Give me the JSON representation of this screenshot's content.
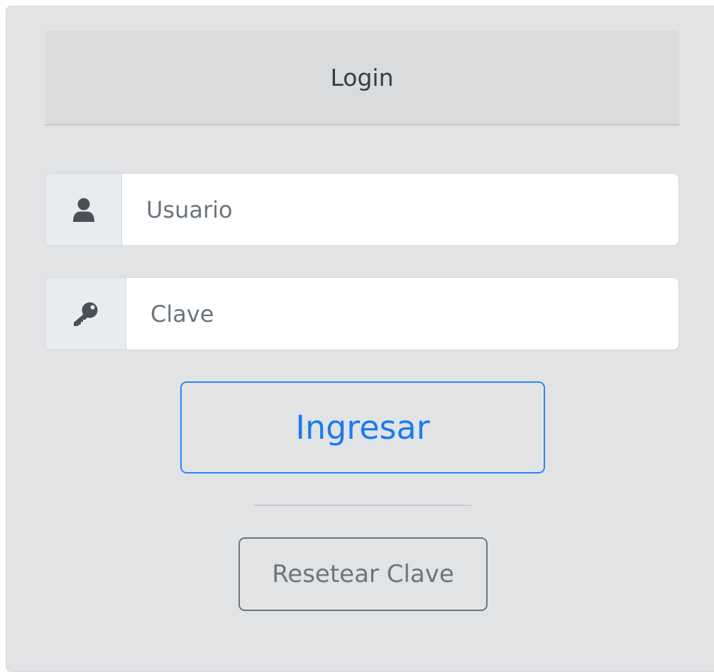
{
  "card": {
    "header_title": "Login"
  },
  "login_form": {
    "username": {
      "placeholder": "Usuario",
      "value": "",
      "icon": "user-icon"
    },
    "password": {
      "placeholder": "Clave",
      "value": "",
      "icon": "key-icon"
    },
    "submit_label": "Ingresar",
    "reset_label": "Resetear Clave"
  },
  "colors": {
    "card_background": "#e2e3e5",
    "header_background": "#dadbdd",
    "primary": "#1a7bf0",
    "secondary": "#6c757d",
    "icon": "#495057"
  }
}
